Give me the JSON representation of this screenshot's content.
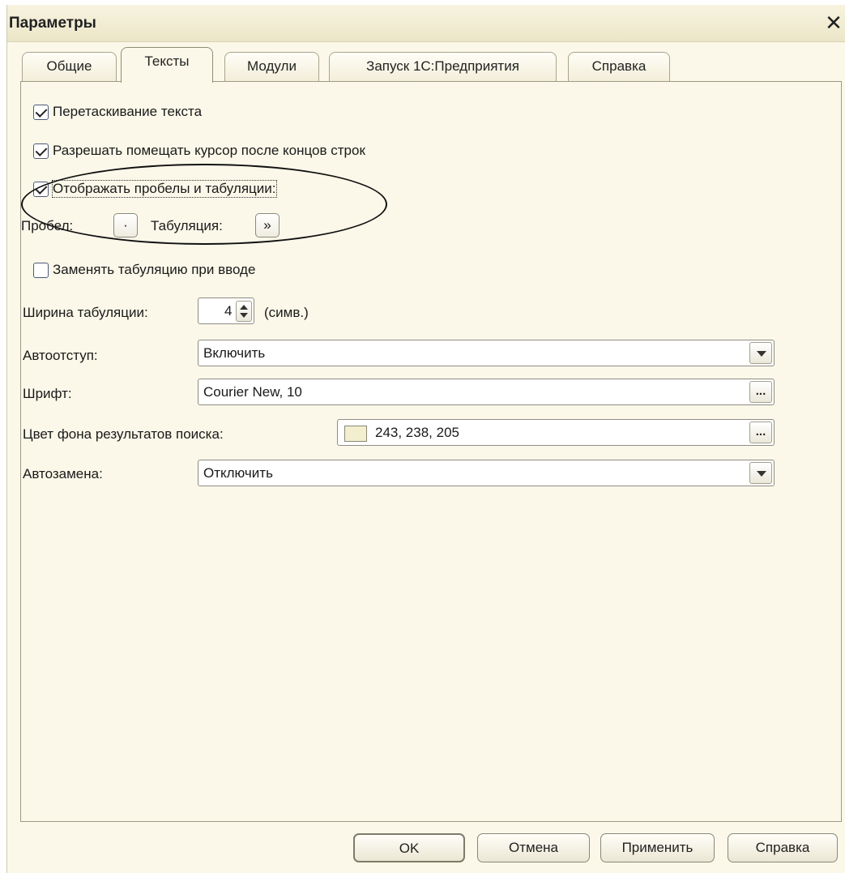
{
  "window": {
    "title": "Параметры"
  },
  "tabs": [
    {
      "label": "Общие"
    },
    {
      "label": "Тексты"
    },
    {
      "label": "Модули"
    },
    {
      "label": "Запуск 1С:Предприятия"
    },
    {
      "label": "Справка"
    }
  ],
  "active_tab": "Тексты",
  "options": {
    "drag_text": {
      "label": "Перетаскивание текста",
      "checked": true
    },
    "cursor_after_eol": {
      "label": "Разрешать помещать курсор после концов строк",
      "checked": true
    },
    "show_whitespace": {
      "label": "Отображать пробелы и табуляции:",
      "checked": true
    },
    "space_label": "Пробел:",
    "space_symbol": "·",
    "tab_label": "Табуляция:",
    "tab_symbol": "»",
    "replace_tabs": {
      "label": "Заменять табуляцию при вводе",
      "checked": false
    },
    "tab_width": {
      "label": "Ширина табуляции:",
      "value": "4",
      "unit": "(симв.)"
    },
    "autoindent": {
      "label": "Автоотступ:",
      "value": "Включить"
    },
    "font": {
      "label": "Шрифт:",
      "value": "Courier New, 10"
    },
    "search_bg": {
      "label": "Цвет фона результатов поиска:",
      "value": "243, 238, 205",
      "color": "#f3eecd"
    },
    "autoreplace": {
      "label": "Автозамена:",
      "value": "Отключить"
    }
  },
  "buttons": {
    "ok": "OK",
    "cancel": "Отмена",
    "apply": "Применить",
    "help": "Справка"
  },
  "colors": {
    "dialog_bg": "#fbf8e9",
    "field_bg": "#ffffff",
    "border": "#9d9a84"
  }
}
